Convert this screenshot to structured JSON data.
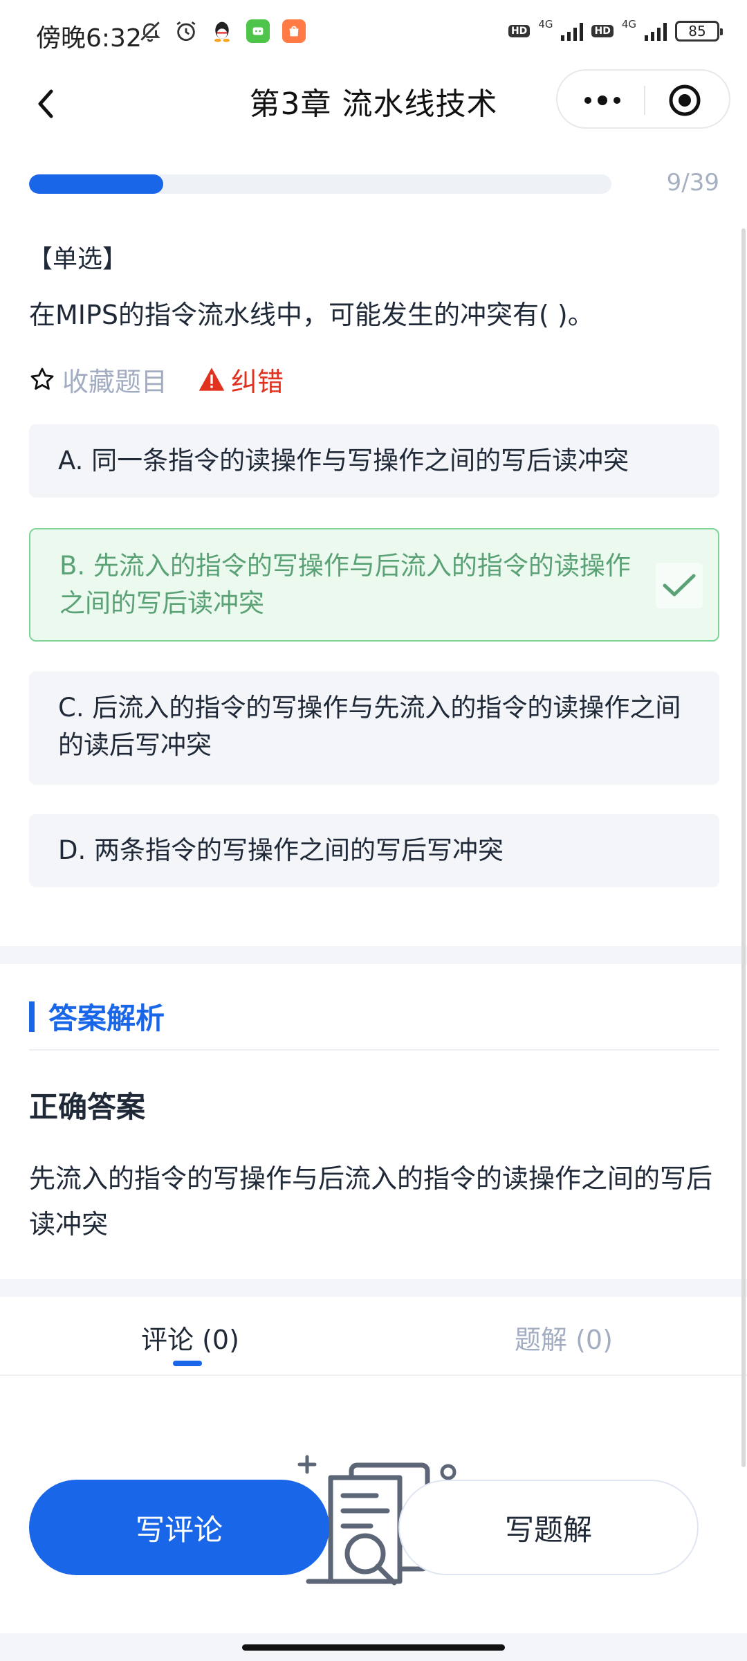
{
  "status_bar": {
    "time": "傍晚6:32",
    "battery": "85",
    "net1": "4G",
    "net2": "4G",
    "hd": "HD"
  },
  "nav": {
    "title": "第3章 流水线技术"
  },
  "progress": {
    "current": 9,
    "total": 39,
    "label": "9/39",
    "fraction": 0.23
  },
  "question": {
    "type_label": "【单选】",
    "stem": "在MIPS的指令流水线中，可能发生的冲突有(    )。",
    "favorite_label": "收藏题目",
    "report_label": "纠错",
    "options": [
      {
        "text": "A. 同一条指令的读操作与写操作之间的写后读冲突"
      },
      {
        "text": "B. 先流入的指令的写操作与后流入的指令的读操作之间的写后读冲突",
        "selected": true,
        "correct": true
      },
      {
        "text": "C. 后流入的指令的写操作与先流入的指令的读操作之间的读后写冲突"
      },
      {
        "text": "D. 两条指令的写操作之间的写后写冲突"
      }
    ]
  },
  "analysis": {
    "section_title": "答案解析",
    "correct_title": "正确答案",
    "correct_text": "先流入的指令的写操作与后流入的指令的读操作之间的写后读冲突"
  },
  "tabs": [
    {
      "label": "评论 (0)",
      "active": true
    },
    {
      "label": "题解 (0)",
      "active": false
    }
  ],
  "actions": {
    "write_comment": "写评论",
    "write_solution": "写题解"
  },
  "colors": {
    "primary": "#1a66e8",
    "correct_bg": "#ebf9ef",
    "correct_border": "#7ed396",
    "correct_text": "#5aa275",
    "report": "#e0321e"
  }
}
